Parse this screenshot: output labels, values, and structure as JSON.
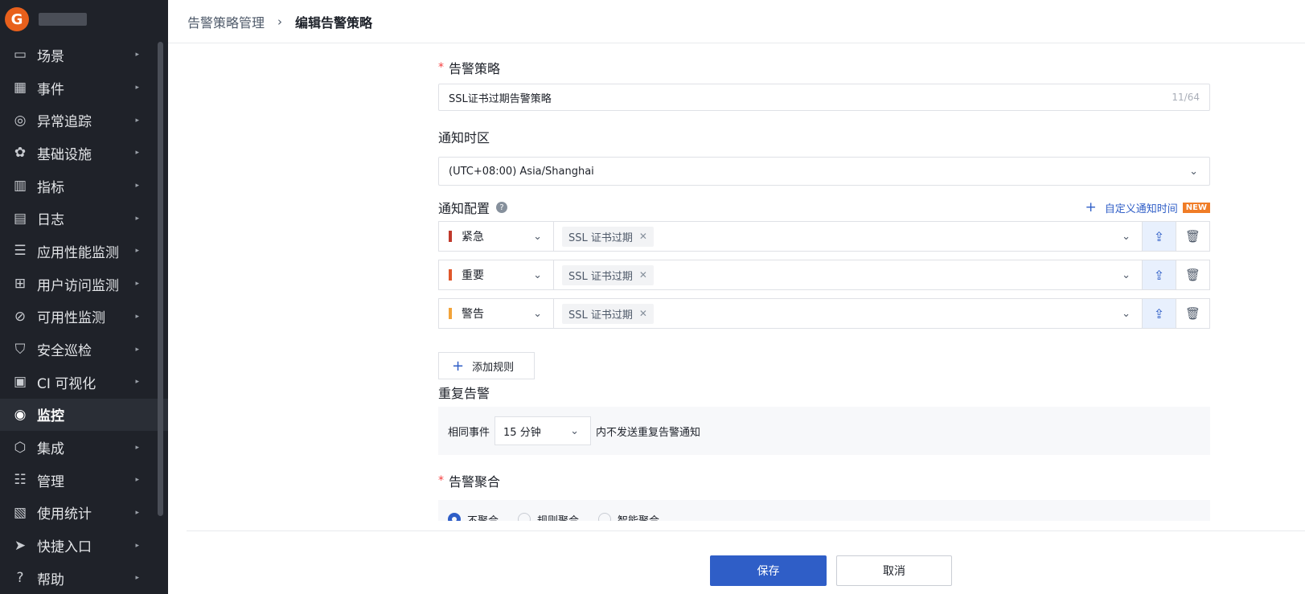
{
  "sidebar": {
    "logo_letter": "G",
    "items": [
      {
        "label": "场景",
        "icon": "monitor-icon"
      },
      {
        "label": "事件",
        "icon": "calendar-icon"
      },
      {
        "label": "异常追踪",
        "icon": "target-icon"
      },
      {
        "label": "基础设施",
        "icon": "nodes-icon"
      },
      {
        "label": "指标",
        "icon": "chart-icon"
      },
      {
        "label": "日志",
        "icon": "log-icon"
      },
      {
        "label": "应用性能监测",
        "icon": "list-icon"
      },
      {
        "label": "用户访问监测",
        "icon": "grid-icon"
      },
      {
        "label": "可用性监测",
        "icon": "gauge-icon"
      },
      {
        "label": "安全巡检",
        "icon": "shield-icon"
      },
      {
        "label": "CI 可视化",
        "icon": "pipeline-icon"
      },
      {
        "label": "监控",
        "icon": "monitor-cam-icon",
        "active": true
      },
      {
        "label": "集成",
        "icon": "hex-icon"
      },
      {
        "label": "管理",
        "icon": "sliders-icon"
      },
      {
        "label": "使用统计",
        "icon": "billing-icon"
      },
      {
        "label": "快捷入口",
        "icon": "send-icon"
      },
      {
        "label": "帮助",
        "icon": "help-icon"
      }
    ]
  },
  "breadcrumb": {
    "parent": "告警策略管理",
    "separator": "›",
    "current": "编辑告警策略"
  },
  "form": {
    "policy_label": "告警策略",
    "policy_value": "SSL证书过期告警策略",
    "policy_counter": "11/64",
    "tz_label": "通知时区",
    "tz_value": "(UTC+08:00) Asia/Shanghai",
    "notify_label": "通知配置",
    "custom_time_label": "自定义通知时间",
    "new_badge": "NEW",
    "rules": [
      {
        "level": "紧急",
        "color": "#c0392b",
        "tag": "SSL 证书过期"
      },
      {
        "level": "重要",
        "color": "#e0572b",
        "tag": "SSL 证书过期"
      },
      {
        "level": "警告",
        "color": "#f2a33a",
        "tag": "SSL 证书过期"
      }
    ],
    "add_rule_label": "添加规则",
    "repeat_label": "重复告警",
    "repeat_prefix": "相同事件",
    "repeat_value": "15 分钟",
    "repeat_suffix": "内不发送重复告警通知",
    "agg_label": "告警聚合",
    "agg_options": [
      "不聚合",
      "规则聚合",
      "智能聚合"
    ],
    "agg_selected": "不聚合"
  },
  "footer": {
    "save_label": "保存",
    "cancel_label": "取消"
  }
}
